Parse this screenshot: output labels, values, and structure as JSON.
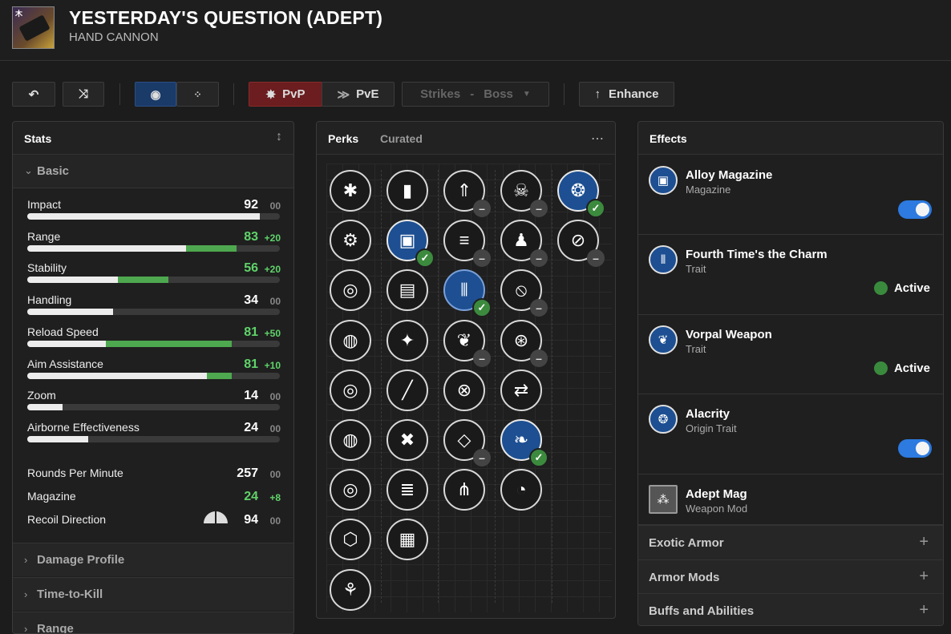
{
  "weapon": {
    "name": "YESTERDAY'S QUESTION (ADEPT)",
    "type": "HAND CANNON",
    "icon_tag": "木"
  },
  "toolbar": {
    "undo_icon": "undo-icon",
    "random_icon": "shuffle-icon",
    "view1_icon": "circle-target-icon",
    "view2_icon": "grid-icon",
    "pvp_label": "PvP",
    "pve_label": "PvE",
    "activity": "Strikes",
    "activity_sep": "-",
    "activity_sub": "Boss",
    "enhance_label": "Enhance",
    "colors": {
      "pvp": "#6b1d1f",
      "active_blue": "#1a3a68"
    }
  },
  "stats_panel": {
    "title": "Stats",
    "basic_label": "Basic",
    "stats": [
      {
        "name": "Impact",
        "value": "92",
        "bonus": "00",
        "fill": 92,
        "green": 0
      },
      {
        "name": "Range",
        "value": "83",
        "bonus": "+20",
        "fill": 63,
        "green": 20
      },
      {
        "name": "Stability",
        "value": "56",
        "bonus": "+20",
        "fill": 36,
        "green": 20
      },
      {
        "name": "Handling",
        "value": "34",
        "bonus": "00",
        "fill": 34,
        "green": 0
      },
      {
        "name": "Reload Speed",
        "value": "81",
        "bonus": "+50",
        "fill": 31,
        "green": 50
      },
      {
        "name": "Aim Assistance",
        "value": "81",
        "bonus": "+10",
        "fill": 71,
        "green": 10
      },
      {
        "name": "Zoom",
        "value": "14",
        "bonus": "00",
        "fill": 14,
        "green": 0
      },
      {
        "name": "Airborne Effectiveness",
        "value": "24",
        "bonus": "00",
        "fill": 24,
        "green": 0
      }
    ],
    "extras": [
      {
        "name": "Rounds Per Minute",
        "value": "257",
        "bonus": "00"
      },
      {
        "name": "Magazine",
        "value": "24",
        "bonus": "+8"
      },
      {
        "name": "Recoil Direction",
        "value": "94",
        "bonus": "00"
      }
    ],
    "sections": [
      "Damage Profile",
      "Time-to-Kill",
      "Range"
    ]
  },
  "perks_panel": {
    "tab_perks": "Perks",
    "tab_curated": "Curated",
    "more": "⋯"
  },
  "effects_panel": {
    "title": "Effects",
    "items": [
      {
        "name": "Alloy Magazine",
        "sub": "Magazine",
        "control": "toggle"
      },
      {
        "name": "Fourth Time's the Charm",
        "sub": "Trait",
        "control": "active",
        "active_label": "Active"
      },
      {
        "name": "Vorpal Weapon",
        "sub": "Trait",
        "control": "active",
        "active_label": "Active"
      },
      {
        "name": "Alacrity",
        "sub": "Origin Trait",
        "control": "toggle"
      },
      {
        "name": "Adept Mag",
        "sub": "Weapon Mod",
        "control": "none"
      }
    ],
    "accordions": [
      "Exotic Armor",
      "Armor Mods",
      "Buffs and Abilities"
    ]
  }
}
